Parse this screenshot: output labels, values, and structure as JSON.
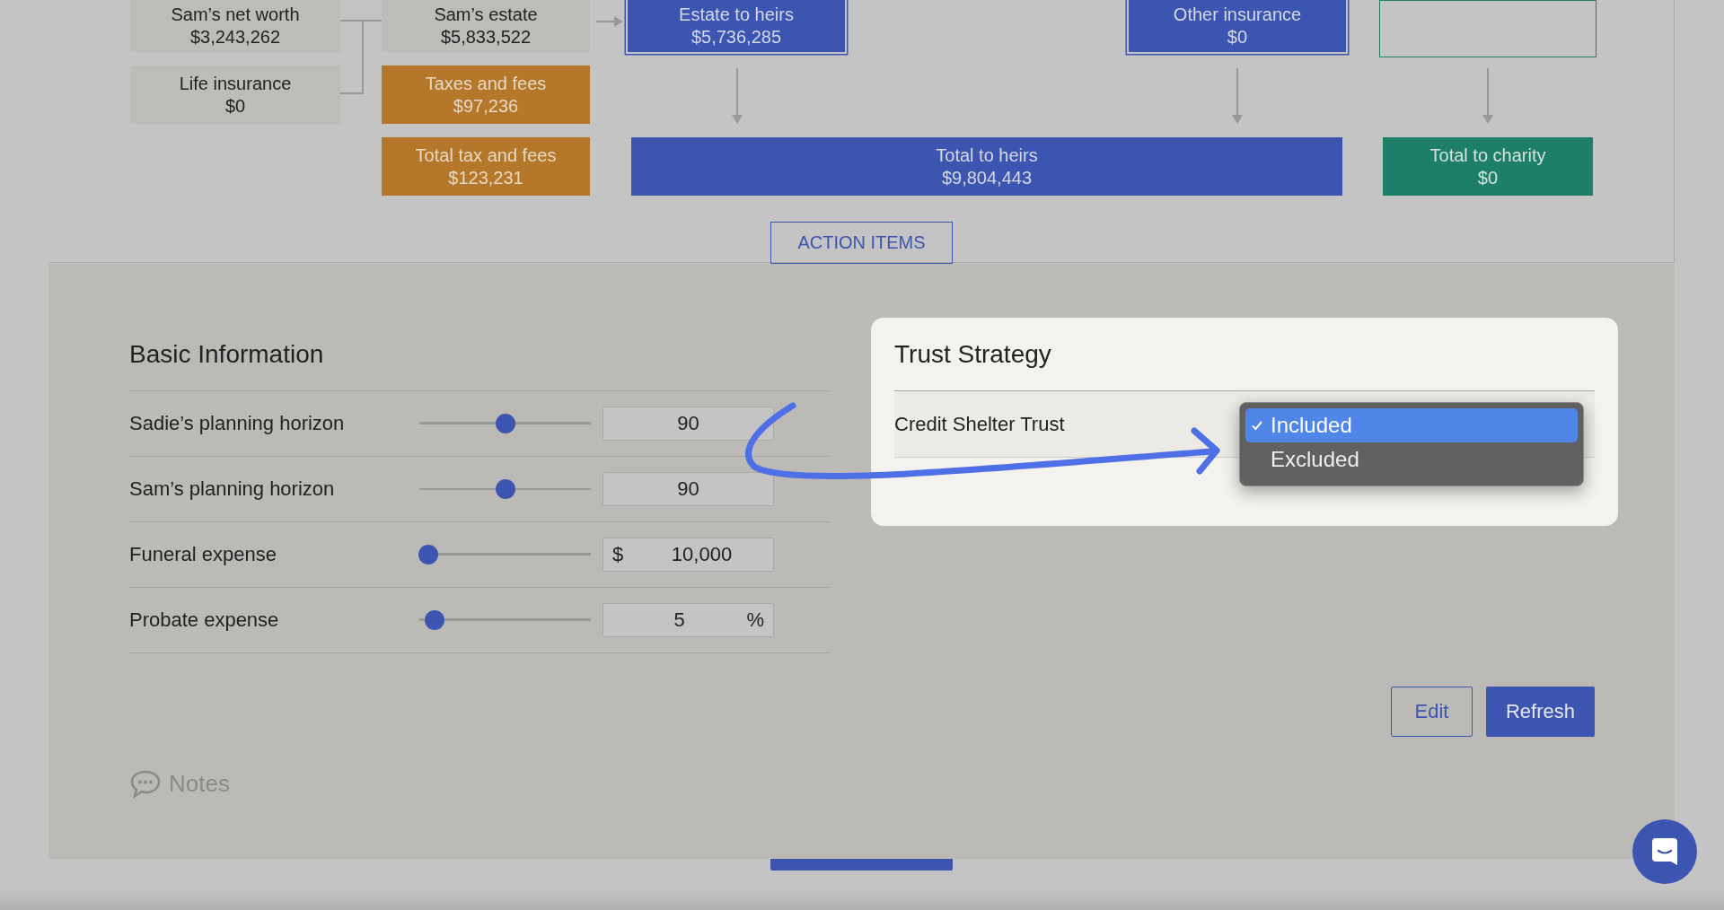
{
  "flow": {
    "nodes": [
      {
        "kind": "neutral",
        "label": "Sam’s net worth",
        "value": "$3,243,262"
      },
      {
        "kind": "neutral",
        "label": "Sam’s estate",
        "value": "$5,833,522"
      },
      {
        "kind": "heirs-framed",
        "label": "Estate to heirs",
        "value": "$5,736,285"
      },
      {
        "kind": "heirs-framed",
        "label": "Other insurance",
        "value": "$0"
      },
      {
        "kind": "charity-outline"
      },
      {
        "kind": "neutral",
        "label": "Life insurance",
        "value": "$0"
      },
      {
        "kind": "tax",
        "label": "Taxes and fees",
        "value": "$97,236"
      },
      {
        "kind": "tax",
        "label": "Total tax and fees",
        "value": "$123,231"
      },
      {
        "kind": "heirs",
        "label": "Total to heirs",
        "value": "$9,804,443"
      },
      {
        "kind": "charity",
        "label": "Total to charity",
        "value": "$0"
      }
    ],
    "action_button": "ACTION ITEMS"
  },
  "basic_information": {
    "title": "Basic Information",
    "rows": [
      {
        "label": "Sadie’s planning horizon",
        "level": 0.5,
        "value": "90"
      },
      {
        "label": "Sam’s planning horizon",
        "level": 0.5,
        "value": "90"
      },
      {
        "label": "Funeral expense",
        "level": 0.05,
        "prefix": "$",
        "value": "10,000"
      },
      {
        "label": "Probate expense",
        "level": 0.09,
        "value": "5",
        "suffix": "%"
      }
    ]
  },
  "trust_strategy": {
    "title": "Trust Strategy",
    "rows": [
      {
        "label": "Credit Shelter Trust",
        "options": [
          {
            "label": "Included",
            "selected": true
          },
          {
            "label": "Excluded",
            "selected": false
          }
        ]
      }
    ]
  },
  "buttons": [
    {
      "label": "Edit",
      "kind": "outline"
    },
    {
      "label": "Refresh",
      "kind": "filled"
    }
  ],
  "notes": "Notes"
}
